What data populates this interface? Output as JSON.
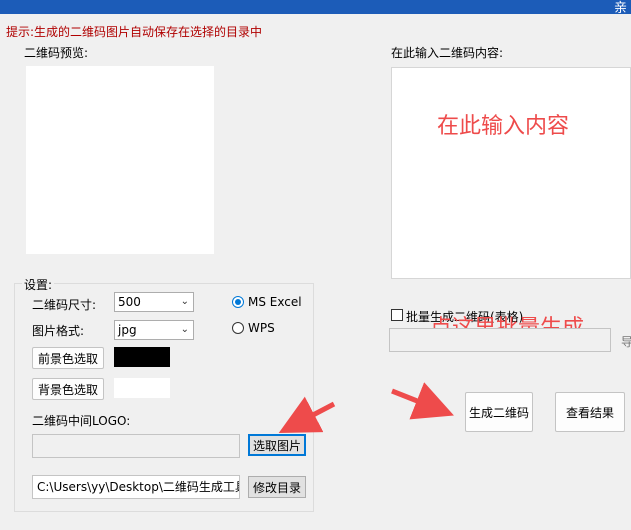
{
  "window": {
    "title_fragment": "亲"
  },
  "hint": "提示:生成的二维码图片自动保存在选择的目录中",
  "preview": {
    "label": "二维码预览:"
  },
  "content": {
    "label": "在此输入二维码内容:",
    "placeholder_overlay": "在此输入内容"
  },
  "settings": {
    "title": "设置:",
    "size_label": "二维码尺寸:",
    "size_value": "500",
    "format_label": "图片格式:",
    "format_value": "jpg",
    "radio_ms": "MS  Excel",
    "radio_wps": "WPS",
    "fg_button": "前景色选取",
    "bg_button": "背景色选取",
    "fg_color": "#000000",
    "bg_color": "#ffffff",
    "logo_label": "二维码中间LOGO:",
    "logo_button": "选取图片",
    "dir_value": "C:\\Users\\yy\\Desktop\\二维码生成工具",
    "dir_button": "修改目录"
  },
  "batch": {
    "checkbox_label": "批量生成二维码(表格)",
    "overlay": "点这里批量生成",
    "side_char": "导"
  },
  "actions": {
    "generate_button": "生成二维码",
    "view_button": "查看结果"
  },
  "icons": {
    "arrow": "red-arrow-icon",
    "chevron": "chevron-down-icon"
  },
  "colors": {
    "titlebar": "#1c5cb8",
    "hint": "#b00000",
    "annotation": "#ee4b4b",
    "accent": "#0078d7"
  }
}
